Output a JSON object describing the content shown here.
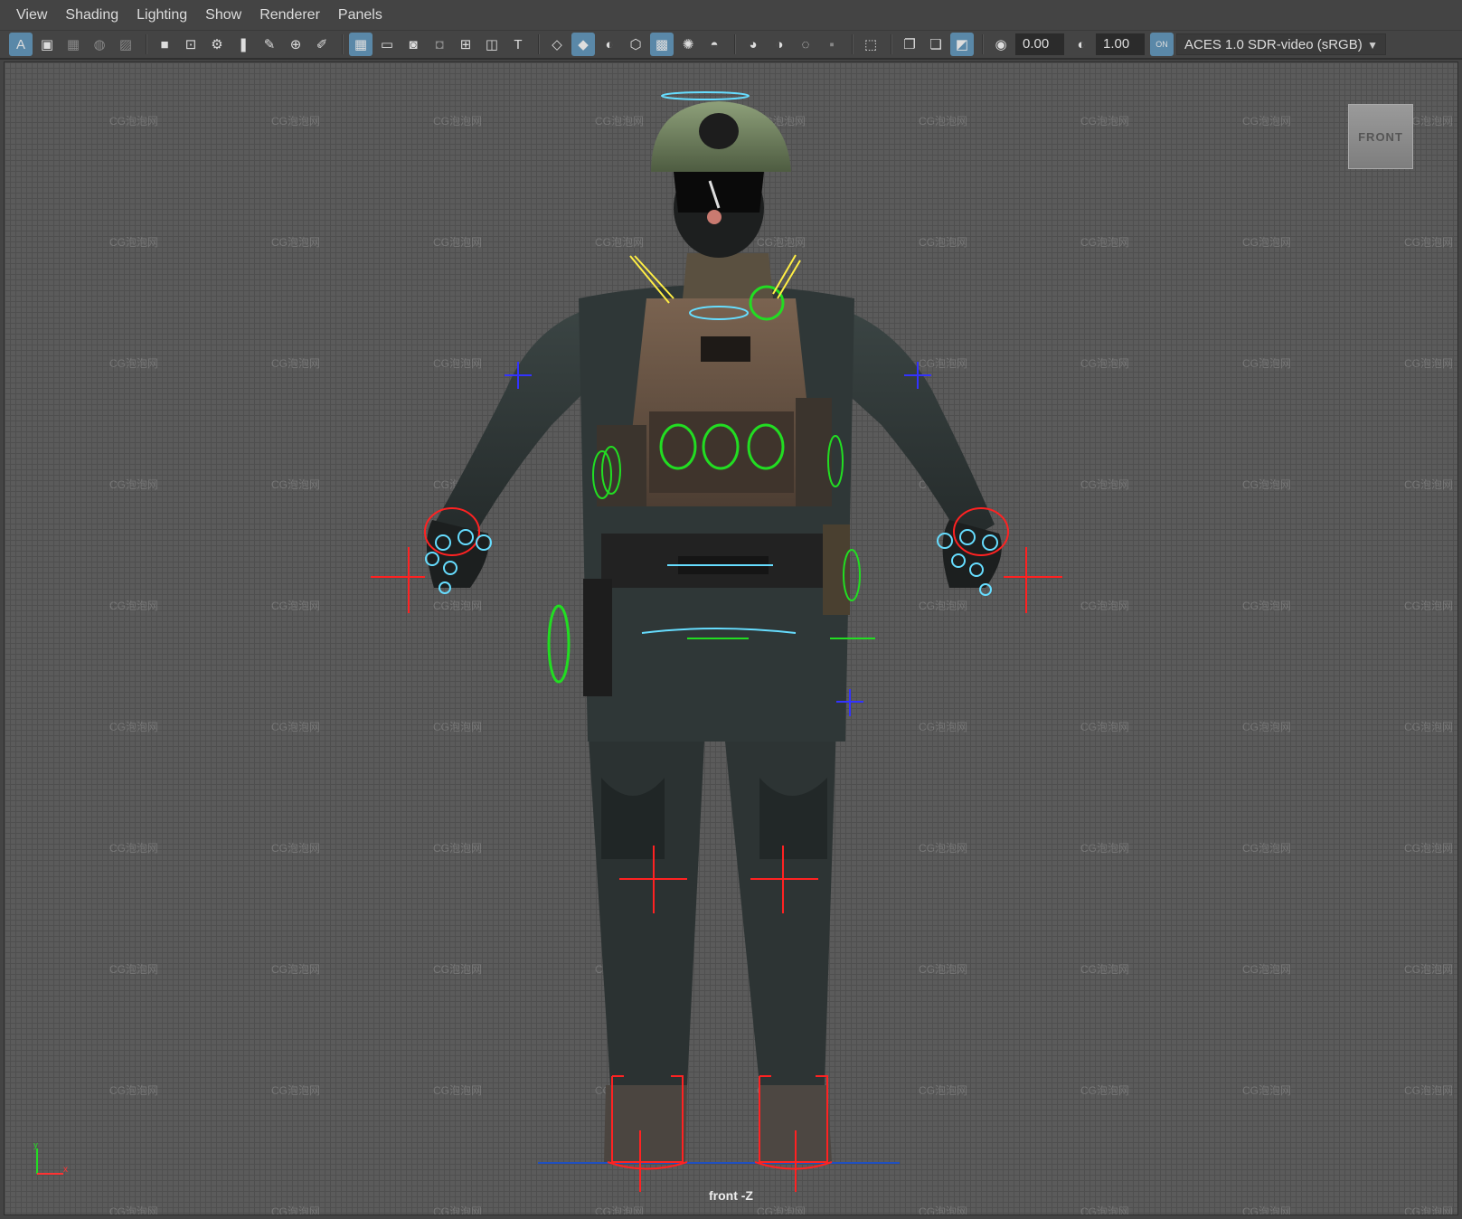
{
  "menu": {
    "items": [
      "View",
      "Shading",
      "Lighting",
      "Show",
      "Renderer",
      "Panels"
    ]
  },
  "toolbar": {
    "groups": [
      [
        "select-camera-icon",
        "camera-attributes-icon",
        "bookmarks-icon",
        "image-plane-icon",
        "2d-pan-zoom-icon"
      ],
      [
        "camera-icon",
        "lock-camera-icon",
        "camera-settings-icon",
        "bookmark-icon",
        "grease-pencil-icon",
        "snap-icon",
        "paint-icon"
      ],
      [
        "grid-icon",
        "film-gate-icon",
        "resolution-gate-icon",
        "gate-mask-icon",
        "field-chart-icon",
        "safe-action-icon",
        "safe-title-icon"
      ],
      [
        "wireframe-icon",
        "smooth-shade-icon",
        "shade-selected-icon",
        "wireframe-on-shaded-icon",
        "textured-icon",
        "lights-icon",
        "shadows-icon"
      ],
      [
        "screen-space-ao-icon",
        "motion-blur-icon",
        "anti-aliasing-icon",
        "depth-of-field-icon"
      ],
      [
        "isolate-select-icon"
      ],
      [
        "xray-icon",
        "xray-active-icon",
        "xray-joints-icon"
      ]
    ],
    "exposure": "0.00",
    "gamma": "1.00",
    "colorspace_toggle": "ON",
    "colorspace": "ACES 1.0 SDR-video (sRGB)"
  },
  "viewport": {
    "watermark": "CG泡泡网",
    "viewcube_label": "FRONT",
    "camera_label": "front -Z",
    "axis": {
      "y": "y",
      "x": "x"
    },
    "colors": {
      "background": "#5b5b5b",
      "grid": "#4f4f4f",
      "fk_controls": "#22dd22",
      "ik_controls": "#ff2222",
      "finger_controls": "#66ddff",
      "pole_vectors": "#3333ff",
      "head_controls": "#ffee44"
    }
  }
}
